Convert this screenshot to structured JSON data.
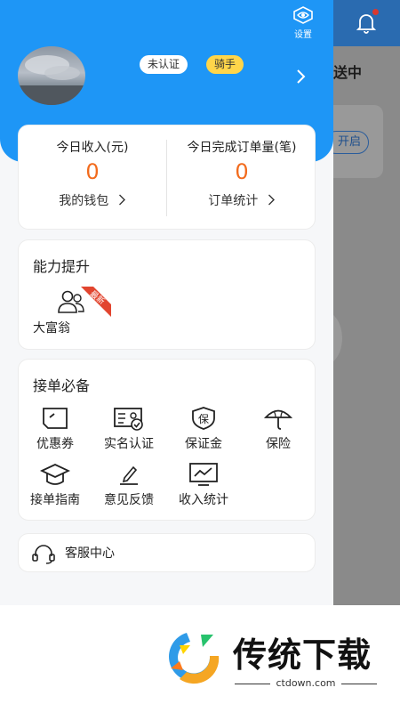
{
  "background": {
    "status_text": "送中",
    "button_text": "开启"
  },
  "header": {
    "settings_label": "设置",
    "user_name": "",
    "badge_unverified": "未认证",
    "badge_rider": "骑手"
  },
  "stats": {
    "income_label": "今日收入(元)",
    "income_value": "0",
    "wallet_link": "我的钱包",
    "orders_label": "今日完成订单量(笔)",
    "orders_value": "0",
    "orders_link": "订单统计"
  },
  "ability": {
    "title": "能力提升",
    "new_tag": "最新",
    "item_label": "大富翁"
  },
  "essentials": {
    "title": "接单必备",
    "items": [
      {
        "label": "优惠券",
        "icon": "coupon-icon"
      },
      {
        "label": "实名认证",
        "icon": "id-card-icon"
      },
      {
        "label": "保证金",
        "icon": "deposit-shield-icon"
      },
      {
        "label": "保险",
        "icon": "umbrella-icon"
      },
      {
        "label": "接单指南",
        "icon": "graduation-cap-icon"
      },
      {
        "label": "意见反馈",
        "icon": "pencil-icon"
      },
      {
        "label": "收入统计",
        "icon": "chart-monitor-icon"
      }
    ]
  },
  "service": {
    "label": "客服中心"
  },
  "watermark": {
    "title": "传统下载",
    "domain": "ctdown.com"
  },
  "colors": {
    "header_blue": "#1e96f6",
    "value_orange": "#f26b1d",
    "badge_yellow": "#ffd54a",
    "new_tag_red": "#e2452f"
  }
}
